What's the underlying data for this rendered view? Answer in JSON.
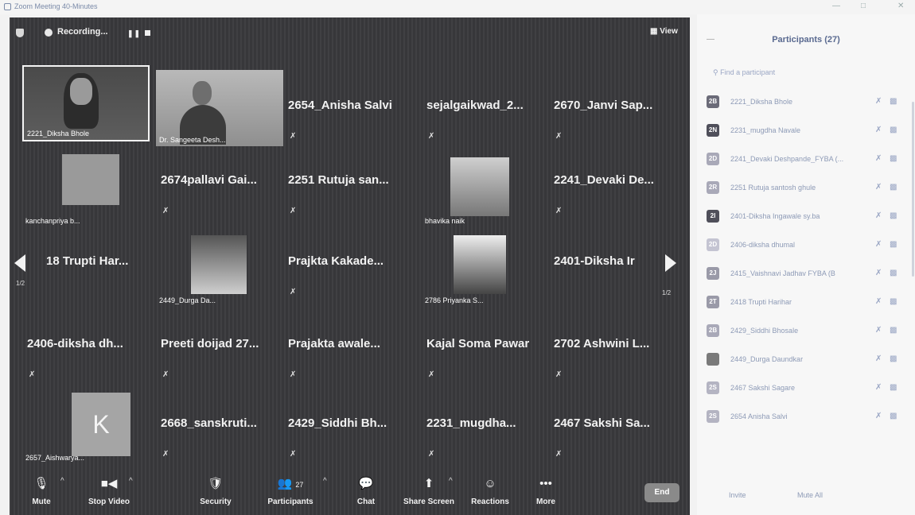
{
  "window": {
    "title": "Zoom Meeting 40-Minutes"
  },
  "topbar": {
    "recording_label": "Recording...",
    "view_label": "View"
  },
  "tiles": [
    {
      "name": "",
      "caption": "2221_Diksha Bhole"
    },
    {
      "name": "",
      "caption": "Dr. Sangeeta Desh..."
    },
    {
      "name": "2654_Anisha Salvi",
      "caption": ""
    },
    {
      "name": "sejalgaikwad_2...",
      "caption": ""
    },
    {
      "name": "2670_Janvi Sap...",
      "caption": ""
    },
    {
      "name": "",
      "caption": "kanchanpriya b..."
    },
    {
      "name": "2674pallavi Gai...",
      "caption": ""
    },
    {
      "name": "2251 Rutuja san...",
      "caption": ""
    },
    {
      "name": "",
      "caption": "bhavika naik"
    },
    {
      "name": "2241_Devaki De...",
      "caption": ""
    },
    {
      "name": "18 Trupti Har...",
      "caption": ""
    },
    {
      "name": "",
      "caption": "2449_Durga Da..."
    },
    {
      "name": "Prajkta Kakade...",
      "caption": ""
    },
    {
      "name": "",
      "caption": "2786 Priyanka S..."
    },
    {
      "name": "2401-Diksha Ir",
      "caption": ""
    },
    {
      "name": "2406-diksha dh...",
      "caption": ""
    },
    {
      "name": "Preeti doijad 27...",
      "caption": ""
    },
    {
      "name": "Prajakta awale...",
      "caption": ""
    },
    {
      "name": "Kajal Soma Pawar",
      "caption": ""
    },
    {
      "name": "2702 Ashwini L...",
      "caption": ""
    },
    {
      "name": "",
      "caption": "2657_Aishwarya..."
    },
    {
      "name": "2668_sanskruti...",
      "caption": ""
    },
    {
      "name": "2429_Siddhi Bh...",
      "caption": ""
    },
    {
      "name": "2231_mugdha...",
      "caption": ""
    },
    {
      "name": "2467 Sakshi Sa...",
      "caption": ""
    }
  ],
  "k_avatar_letter": "K",
  "pagination": {
    "left": "1/2",
    "right": "1/2"
  },
  "controls": {
    "mute": "Mute",
    "stop_video": "Stop Video",
    "security": "Security",
    "participants": "Participants",
    "participants_count": "27",
    "chat": "Chat",
    "share_screen": "Share Screen",
    "reactions": "Reactions",
    "more": "More",
    "end": "End"
  },
  "sidebar": {
    "title": "Participants (27)",
    "search_placeholder": "Find a participant",
    "participants": [
      {
        "initials": "2B",
        "name": "2221_Diksha Bhole",
        "color": "#6b6b78"
      },
      {
        "initials": "2N",
        "name": "2231_mugdha Navale",
        "color": "#4f4f5a"
      },
      {
        "initials": "2D",
        "name": "2241_Devaki Deshpande_FYBA (...",
        "color": "#a9a9b8"
      },
      {
        "initials": "2R",
        "name": "2251 Rutuja santosh ghule",
        "color": "#a9a9b8"
      },
      {
        "initials": "2I",
        "name": "2401-Diksha Ingawale sy.ba",
        "color": "#4f4f5a"
      },
      {
        "initials": "2D",
        "name": "2406-diksha dhumal",
        "color": "#c4c4d2"
      },
      {
        "initials": "2J",
        "name": "2415_Vaishnavi Jadhav FYBA (B",
        "color": "#9a9aa8"
      },
      {
        "initials": "2T",
        "name": "2418 Trupti Harihar",
        "color": "#9a9aa8"
      },
      {
        "initials": "2B",
        "name": "2429_Siddhi Bhosale",
        "color": "#a9a9b8"
      },
      {
        "initials": "",
        "name": "2449_Durga Daundkar",
        "color": "#7a7a7a"
      },
      {
        "initials": "2S",
        "name": "2467 Sakshi Sagare",
        "color": "#b4b4c2"
      },
      {
        "initials": "2S",
        "name": "2654 Anisha Salvi",
        "color": "#b4b4c2"
      }
    ],
    "invite": "Invite",
    "mute_all": "Mute All"
  }
}
